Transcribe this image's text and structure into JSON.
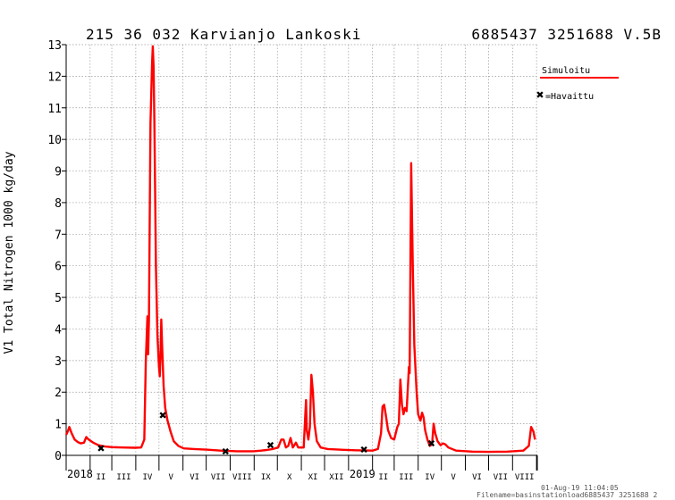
{
  "header": {
    "station": "215 36 032 Karvianjo Lankoski",
    "code": "6885437 3251688 V.5B"
  },
  "legend": {
    "simulated_label": "Simuloitu",
    "observed_label": "=Havaittu"
  },
  "footer": {
    "date": "01-Aug-19 11:04:05",
    "filename": "Filename=basinstationload6885437 3251688 2"
  },
  "chart_data": {
    "type": "line",
    "ylabel": "V1 Total Nitrogen 1000 kg/day",
    "ylim": [
      0,
      13
    ],
    "yticks": [
      0,
      1,
      2,
      3,
      4,
      5,
      6,
      7,
      8,
      9,
      10,
      11,
      12,
      13
    ],
    "xlim": [
      "2018-01-01",
      "2019-09-02"
    ],
    "grid": true,
    "x_month_labels": [
      {
        "date": "2018-02-01",
        "label": "II"
      },
      {
        "date": "2018-03-01",
        "label": "III"
      },
      {
        "date": "2018-04-01",
        "label": "IV"
      },
      {
        "date": "2018-05-01",
        "label": "V"
      },
      {
        "date": "2018-06-01",
        "label": "VI"
      },
      {
        "date": "2018-07-01",
        "label": "VII"
      },
      {
        "date": "2018-08-01",
        "label": "VIII"
      },
      {
        "date": "2018-09-01",
        "label": "IX"
      },
      {
        "date": "2018-10-01",
        "label": "X"
      },
      {
        "date": "2018-11-01",
        "label": "XI"
      },
      {
        "date": "2018-12-01",
        "label": "XII"
      },
      {
        "date": "2019-02-01",
        "label": "II"
      },
      {
        "date": "2019-03-01",
        "label": "III"
      },
      {
        "date": "2019-04-01",
        "label": "IV"
      },
      {
        "date": "2019-05-01",
        "label": "V"
      },
      {
        "date": "2019-06-01",
        "label": "VI"
      },
      {
        "date": "2019-07-01",
        "label": "VII"
      },
      {
        "date": "2019-08-01",
        "label": "VIII"
      }
    ],
    "x_year_labels": [
      {
        "date": "2018-01-01",
        "label": "2018"
      },
      {
        "date": "2019-01-01",
        "label": "2019"
      }
    ],
    "series": [
      {
        "name": "Simuloitu",
        "color": "#ff0000",
        "points": [
          [
            "2018-01-01",
            0.65
          ],
          [
            "2018-01-03",
            0.75
          ],
          [
            "2018-01-05",
            0.9
          ],
          [
            "2018-01-08",
            0.7
          ],
          [
            "2018-01-12",
            0.5
          ],
          [
            "2018-01-16",
            0.42
          ],
          [
            "2018-01-20",
            0.38
          ],
          [
            "2018-01-24",
            0.4
          ],
          [
            "2018-01-27",
            0.58
          ],
          [
            "2018-01-30",
            0.5
          ],
          [
            "2018-02-05",
            0.4
          ],
          [
            "2018-02-12",
            0.32
          ],
          [
            "2018-02-20",
            0.28
          ],
          [
            "2018-03-01",
            0.26
          ],
          [
            "2018-03-15",
            0.25
          ],
          [
            "2018-03-31",
            0.24
          ],
          [
            "2018-04-08",
            0.25
          ],
          [
            "2018-04-12",
            0.5
          ],
          [
            "2018-04-14",
            3.0
          ],
          [
            "2018-04-16",
            4.4
          ],
          [
            "2018-04-17",
            3.2
          ],
          [
            "2018-04-18",
            4.3
          ],
          [
            "2018-04-20",
            10.5
          ],
          [
            "2018-04-22",
            12.4
          ],
          [
            "2018-04-23",
            12.95
          ],
          [
            "2018-04-24",
            12.3
          ],
          [
            "2018-04-25",
            10.5
          ],
          [
            "2018-04-27",
            6.0
          ],
          [
            "2018-04-29",
            3.8
          ],
          [
            "2018-05-01",
            2.8
          ],
          [
            "2018-05-02",
            2.5
          ],
          [
            "2018-05-03",
            3.2
          ],
          [
            "2018-05-04",
            4.3
          ],
          [
            "2018-05-05",
            3.5
          ],
          [
            "2018-05-07",
            2.2
          ],
          [
            "2018-05-09",
            1.5
          ],
          [
            "2018-05-12",
            1.1
          ],
          [
            "2018-05-16",
            0.75
          ],
          [
            "2018-05-20",
            0.45
          ],
          [
            "2018-05-26",
            0.3
          ],
          [
            "2018-06-02",
            0.22
          ],
          [
            "2018-06-15",
            0.2
          ],
          [
            "2018-07-01",
            0.18
          ],
          [
            "2018-07-20",
            0.15
          ],
          [
            "2018-08-10",
            0.13
          ],
          [
            "2018-08-31",
            0.13
          ],
          [
            "2018-09-10",
            0.15
          ],
          [
            "2018-09-17",
            0.17
          ],
          [
            "2018-09-25",
            0.2
          ],
          [
            "2018-10-02",
            0.25
          ],
          [
            "2018-10-06",
            0.5
          ],
          [
            "2018-10-09",
            0.5
          ],
          [
            "2018-10-12",
            0.25
          ],
          [
            "2018-10-15",
            0.3
          ],
          [
            "2018-10-18",
            0.55
          ],
          [
            "2018-10-21",
            0.25
          ],
          [
            "2018-10-25",
            0.4
          ],
          [
            "2018-10-28",
            0.25
          ],
          [
            "2018-11-04",
            0.25
          ],
          [
            "2018-11-07",
            1.75
          ],
          [
            "2018-11-08",
            0.8
          ],
          [
            "2018-11-10",
            0.5
          ],
          [
            "2018-11-12",
            0.9
          ],
          [
            "2018-11-14",
            2.55
          ],
          [
            "2018-11-16",
            2.0
          ],
          [
            "2018-11-18",
            1.0
          ],
          [
            "2018-11-21",
            0.45
          ],
          [
            "2018-11-26",
            0.25
          ],
          [
            "2018-12-05",
            0.2
          ],
          [
            "2018-12-20",
            0.18
          ],
          [
            "2019-01-10",
            0.16
          ],
          [
            "2019-02-01",
            0.15
          ],
          [
            "2019-02-08",
            0.2
          ],
          [
            "2019-02-12",
            0.7
          ],
          [
            "2019-02-14",
            1.55
          ],
          [
            "2019-02-16",
            1.6
          ],
          [
            "2019-02-18",
            1.3
          ],
          [
            "2019-02-21",
            0.8
          ],
          [
            "2019-02-25",
            0.55
          ],
          [
            "2019-03-01",
            0.5
          ],
          [
            "2019-03-05",
            0.9
          ],
          [
            "2019-03-07",
            1.0
          ],
          [
            "2019-03-09",
            2.4
          ],
          [
            "2019-03-11",
            1.6
          ],
          [
            "2019-03-13",
            1.3
          ],
          [
            "2019-03-15",
            1.5
          ],
          [
            "2019-03-17",
            1.4
          ],
          [
            "2019-03-20",
            2.8
          ],
          [
            "2019-03-21",
            2.6
          ],
          [
            "2019-03-23",
            9.25
          ],
          [
            "2019-03-25",
            6.0
          ],
          [
            "2019-03-27",
            3.5
          ],
          [
            "2019-03-30",
            2.0
          ],
          [
            "2019-04-01",
            1.3
          ],
          [
            "2019-04-04",
            1.1
          ],
          [
            "2019-04-06",
            1.35
          ],
          [
            "2019-04-08",
            1.2
          ],
          [
            "2019-04-10",
            0.8
          ],
          [
            "2019-04-13",
            0.5
          ],
          [
            "2019-04-16",
            0.3
          ],
          [
            "2019-04-19",
            0.35
          ],
          [
            "2019-04-21",
            1.0
          ],
          [
            "2019-04-23",
            0.7
          ],
          [
            "2019-04-26",
            0.45
          ],
          [
            "2019-04-30",
            0.32
          ],
          [
            "2019-05-03",
            0.38
          ],
          [
            "2019-05-06",
            0.35
          ],
          [
            "2019-05-10",
            0.25
          ],
          [
            "2019-05-20",
            0.15
          ],
          [
            "2019-06-10",
            0.12
          ],
          [
            "2019-07-01",
            0.11
          ],
          [
            "2019-07-25",
            0.12
          ],
          [
            "2019-08-15",
            0.15
          ],
          [
            "2019-08-22",
            0.3
          ],
          [
            "2019-08-25",
            0.9
          ],
          [
            "2019-08-28",
            0.75
          ],
          [
            "2019-08-30",
            0.5
          ]
        ]
      },
      {
        "name": "Havaittu",
        "color": "#000000",
        "points": [
          [
            "2018-02-15",
            0.2
          ],
          [
            "2018-05-06",
            1.25
          ],
          [
            "2018-07-26",
            0.1
          ],
          [
            "2018-09-22",
            0.3
          ],
          [
            "2019-01-21",
            0.15
          ],
          [
            "2019-04-18",
            0.35
          ]
        ]
      }
    ]
  }
}
